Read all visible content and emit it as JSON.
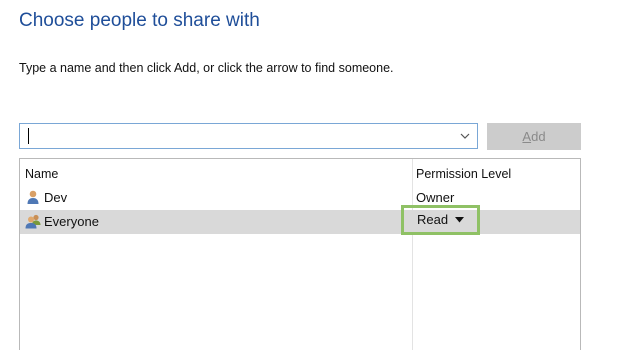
{
  "dialog": {
    "heading": "Choose people to share with",
    "instructions": "Type a name and then click Add, or click the arrow to find someone."
  },
  "name_input": {
    "value": "",
    "dropdown_icon": "chevron-down-icon"
  },
  "add_button": {
    "label_hotkey": "A",
    "label_rest": "dd",
    "enabled": false
  },
  "share_list": {
    "columns": {
      "name": "Name",
      "permission": "Permission Level"
    },
    "rows": [
      {
        "name": "Dev",
        "permission": "Owner",
        "icon": "user-icon",
        "selected": false
      },
      {
        "name": "Everyone",
        "permission": "Read",
        "icon": "group-icon",
        "selected": true
      }
    ]
  },
  "colors": {
    "heading": "#1f4e99",
    "input_border": "#7aa7d6",
    "selected_row": "#d9d9d9",
    "highlight_border": "#8fc165",
    "disabled_button": "#cccccc"
  }
}
